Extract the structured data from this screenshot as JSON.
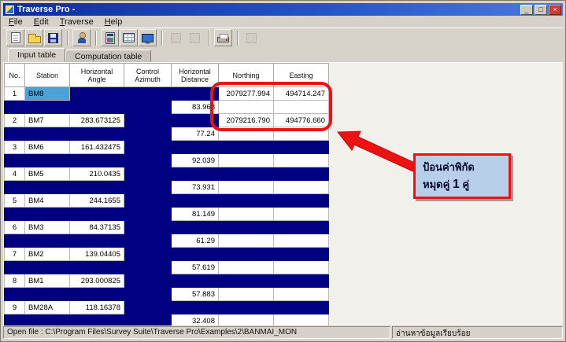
{
  "window": {
    "title": "Traverse Pro -",
    "minimize_label": "_",
    "maximize_label": "□",
    "close_label": "×"
  },
  "menu": {
    "items": [
      "File",
      "Edit",
      "Traverse",
      "Help"
    ]
  },
  "toolbar": {
    "buttons": [
      {
        "name": "new-file",
        "enabled": true,
        "sep_after": false
      },
      {
        "name": "open-file",
        "enabled": true,
        "sep_after": false
      },
      {
        "name": "save-file",
        "enabled": true,
        "sep_after": true
      },
      {
        "name": "edit-points",
        "enabled": true,
        "sep_after": true
      },
      {
        "name": "calculator",
        "enabled": true,
        "sep_after": false
      },
      {
        "name": "data-table",
        "enabled": true,
        "sep_after": false
      },
      {
        "name": "plot-view",
        "enabled": true,
        "sep_after": true
      },
      {
        "name": "tool-a",
        "enabled": false,
        "sep_after": false
      },
      {
        "name": "tool-b",
        "enabled": false,
        "sep_after": true
      },
      {
        "name": "print",
        "enabled": true,
        "sep_after": true
      },
      {
        "name": "tool-c",
        "enabled": false,
        "sep_after": false
      }
    ]
  },
  "tabs": [
    {
      "label": "Input table",
      "active": true
    },
    {
      "label": "Computation table",
      "active": false
    }
  ],
  "table": {
    "headers": [
      "No.",
      "Station",
      "Horizontal\nAngle",
      "Control\nAzimuth",
      "Horizontal\nDistance",
      "Northing",
      "Easting"
    ],
    "rows": [
      {
        "type": "station",
        "no": "1",
        "station": "BM8",
        "angle": "",
        "azimuth": "",
        "distance": "",
        "northing": "2079277.994",
        "easting": "494714.247",
        "coords": true,
        "selected": true
      },
      {
        "type": "distance",
        "no": "",
        "station": "",
        "angle": "",
        "azimuth": "",
        "distance": "83.968",
        "northing": "",
        "easting": ""
      },
      {
        "type": "station",
        "no": "2",
        "station": "BM7",
        "angle": "283.673125",
        "azimuth": "",
        "distance": "",
        "northing": "2079216.790",
        "easting": "494776.660",
        "coords": true,
        "selected": false
      },
      {
        "type": "distance",
        "no": "",
        "station": "",
        "angle": "",
        "azimuth": "",
        "distance": "77.24",
        "northing": "",
        "easting": ""
      },
      {
        "type": "station",
        "no": "3",
        "station": "BM6",
        "angle": "161.432475",
        "azimuth": "",
        "distance": "",
        "northing": "",
        "easting": "",
        "coords": false,
        "selected": false
      },
      {
        "type": "distance",
        "no": "",
        "station": "",
        "angle": "",
        "azimuth": "",
        "distance": "92.039",
        "northing": "",
        "easting": ""
      },
      {
        "type": "station",
        "no": "4",
        "station": "BM5",
        "angle": "210.0435",
        "azimuth": "",
        "distance": "",
        "northing": "",
        "easting": "",
        "coords": false,
        "selected": false
      },
      {
        "type": "distance",
        "no": "",
        "station": "",
        "angle": "",
        "azimuth": "",
        "distance": "73.931",
        "northing": "",
        "easting": ""
      },
      {
        "type": "station",
        "no": "5",
        "station": "BM4",
        "angle": "244.1655",
        "azimuth": "",
        "distance": "",
        "northing": "",
        "easting": "",
        "coords": false,
        "selected": false
      },
      {
        "type": "distance",
        "no": "",
        "station": "",
        "angle": "",
        "azimuth": "",
        "distance": "81.149",
        "northing": "",
        "easting": ""
      },
      {
        "type": "station",
        "no": "6",
        "station": "BM3",
        "angle": "84.37135",
        "azimuth": "",
        "distance": "",
        "northing": "",
        "easting": "",
        "coords": false,
        "selected": false
      },
      {
        "type": "distance",
        "no": "",
        "station": "",
        "angle": "",
        "azimuth": "",
        "distance": "61.29",
        "northing": "",
        "easting": ""
      },
      {
        "type": "station",
        "no": "7",
        "station": "BM2",
        "angle": "139.04405",
        "azimuth": "",
        "distance": "",
        "northing": "",
        "easting": "",
        "coords": false,
        "selected": false
      },
      {
        "type": "distance",
        "no": "",
        "station": "",
        "angle": "",
        "azimuth": "",
        "distance": "57.619",
        "northing": "",
        "easting": ""
      },
      {
        "type": "station",
        "no": "8",
        "station": "BM1",
        "angle": "293.000825",
        "azimuth": "",
        "distance": "",
        "northing": "",
        "easting": "",
        "coords": false,
        "selected": false
      },
      {
        "type": "distance",
        "no": "",
        "station": "",
        "angle": "",
        "azimuth": "",
        "distance": "57.883",
        "northing": "",
        "easting": ""
      },
      {
        "type": "station",
        "no": "9",
        "station": "BM28A",
        "angle": "118.16378",
        "azimuth": "",
        "distance": "",
        "northing": "",
        "easting": "",
        "coords": false,
        "selected": false
      },
      {
        "type": "distance",
        "no": "",
        "station": "",
        "angle": "",
        "azimuth": "",
        "distance": "32.408",
        "northing": "",
        "easting": ""
      }
    ]
  },
  "annotation": {
    "line1": "ป้อนค่าพิกัด",
    "line2_prefix": "หมุดคู่ ",
    "line2_number": "1",
    "line2_suffix": " คู่"
  },
  "statusbar": {
    "open_file": "Open file : C:\\Program Files\\Survey Suite\\Traverse Pro\\Examples\\2\\BANMAI_MON",
    "message": "อ่านหาข้อมูลเรียบร้อย"
  },
  "colors": {
    "cell_navy": "#000080",
    "selection_blue": "#4ba2d6",
    "annotation_red": "#ee1111",
    "callout_bg": "#b8cfe9"
  }
}
